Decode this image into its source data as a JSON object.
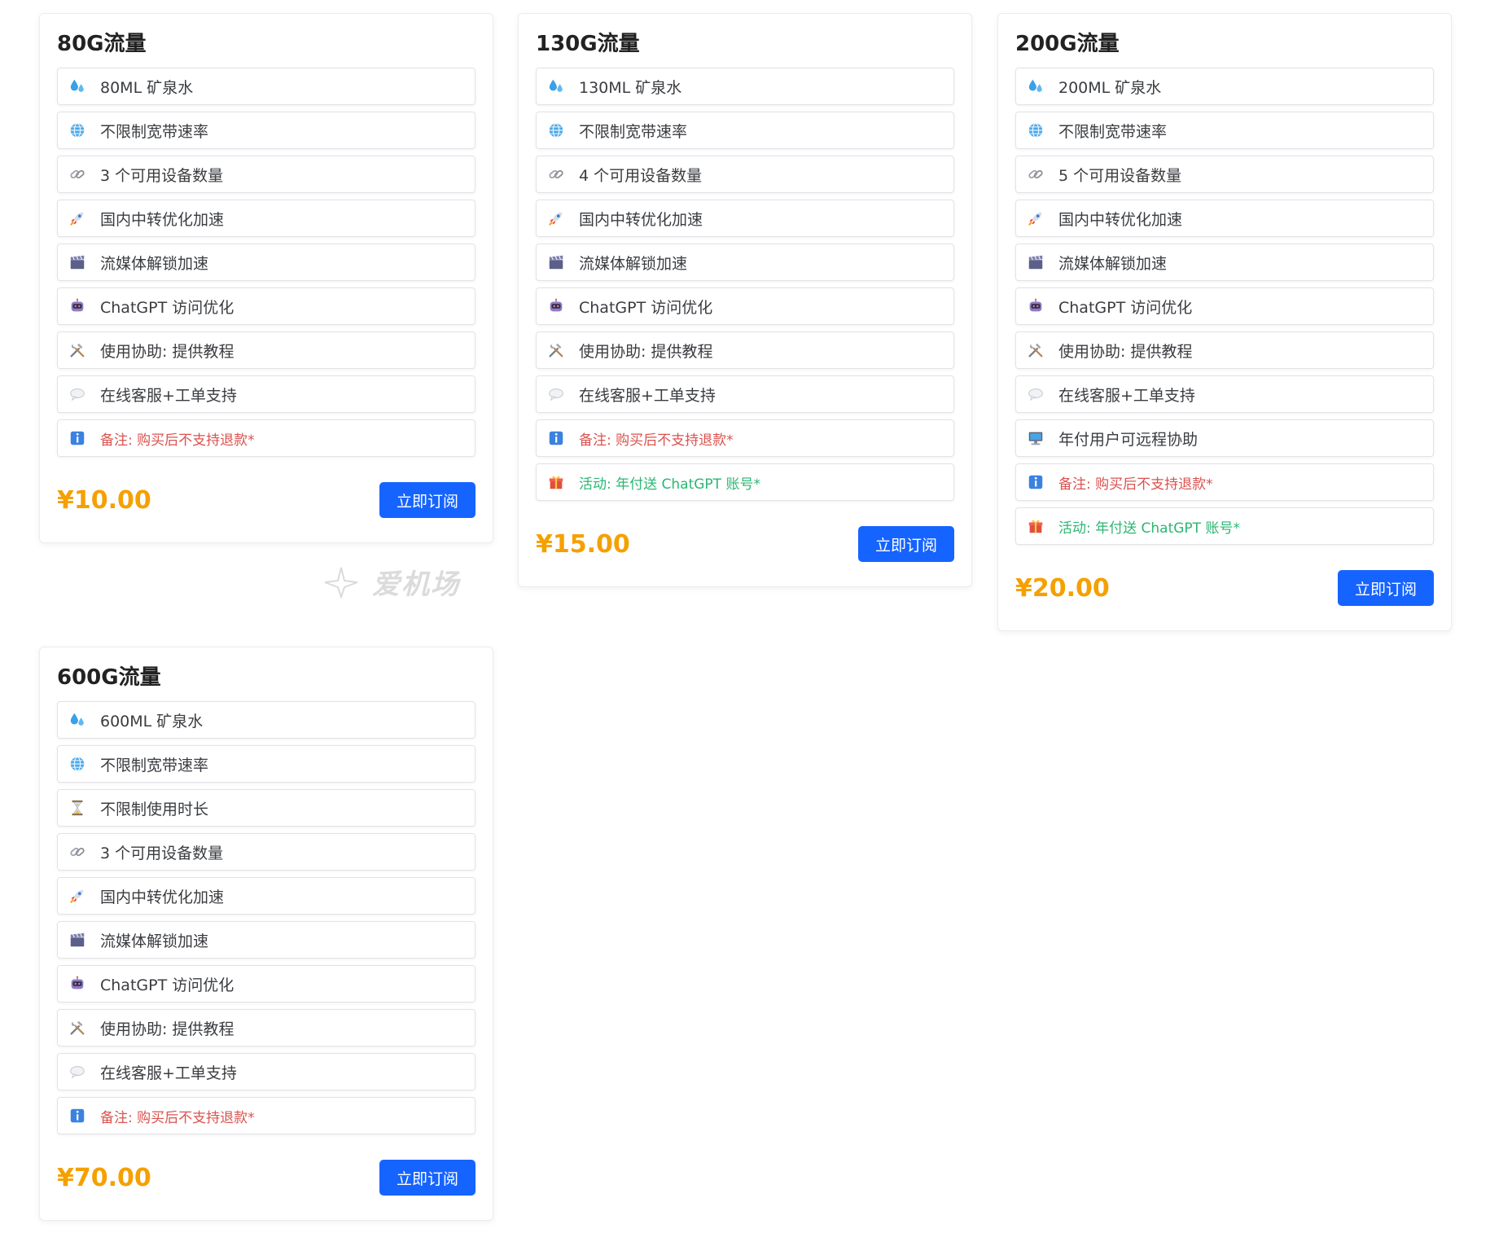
{
  "cards": [
    {
      "title": "80G流量",
      "features": [
        {
          "icon": "water-drops-icon",
          "text": "80ML 矿泉水",
          "kind": "normal"
        },
        {
          "icon": "globe-icon",
          "text": "不限制宽带速率",
          "kind": "normal"
        },
        {
          "icon": "link-icon",
          "text": "3 个可用设备数量",
          "kind": "normal"
        },
        {
          "icon": "rocket-icon",
          "text": "国内中转优化加速",
          "kind": "normal"
        },
        {
          "icon": "clapper-board-icon",
          "text": "流媒体解锁加速",
          "kind": "normal"
        },
        {
          "icon": "robot-icon",
          "text": "ChatGPT 访问优化",
          "kind": "normal"
        },
        {
          "icon": "tools-icon",
          "text": "使用协助: 提供教程",
          "kind": "normal"
        },
        {
          "icon": "speech-bubble-icon",
          "text": "在线客服+工单支持",
          "kind": "normal"
        },
        {
          "icon": "info-icon",
          "text": "备注: 购买后不支持退款*",
          "kind": "note"
        }
      ],
      "price": "¥10.00",
      "button": "立即订阅"
    },
    {
      "title": "130G流量",
      "features": [
        {
          "icon": "water-drops-icon",
          "text": "130ML 矿泉水",
          "kind": "normal"
        },
        {
          "icon": "globe-icon",
          "text": "不限制宽带速率",
          "kind": "normal"
        },
        {
          "icon": "link-icon",
          "text": "4 个可用设备数量",
          "kind": "normal"
        },
        {
          "icon": "rocket-icon",
          "text": "国内中转优化加速",
          "kind": "normal"
        },
        {
          "icon": "clapper-board-icon",
          "text": "流媒体解锁加速",
          "kind": "normal"
        },
        {
          "icon": "robot-icon",
          "text": "ChatGPT 访问优化",
          "kind": "normal"
        },
        {
          "icon": "tools-icon",
          "text": "使用协助: 提供教程",
          "kind": "normal"
        },
        {
          "icon": "speech-bubble-icon",
          "text": "在线客服+工单支持",
          "kind": "normal"
        },
        {
          "icon": "info-icon",
          "text": "备注: 购买后不支持退款*",
          "kind": "note"
        },
        {
          "icon": "gift-icon",
          "text": "活动: 年付送 ChatGPT 账号*",
          "kind": "promo"
        }
      ],
      "price": "¥15.00",
      "button": "立即订阅"
    },
    {
      "title": "200G流量",
      "features": [
        {
          "icon": "water-drops-icon",
          "text": "200ML 矿泉水",
          "kind": "normal"
        },
        {
          "icon": "globe-icon",
          "text": "不限制宽带速率",
          "kind": "normal"
        },
        {
          "icon": "link-icon",
          "text": "5 个可用设备数量",
          "kind": "normal"
        },
        {
          "icon": "rocket-icon",
          "text": "国内中转优化加速",
          "kind": "normal"
        },
        {
          "icon": "clapper-board-icon",
          "text": "流媒体解锁加速",
          "kind": "normal"
        },
        {
          "icon": "robot-icon",
          "text": "ChatGPT 访问优化",
          "kind": "normal"
        },
        {
          "icon": "tools-icon",
          "text": "使用协助: 提供教程",
          "kind": "normal"
        },
        {
          "icon": "speech-bubble-icon",
          "text": "在线客服+工单支持",
          "kind": "normal"
        },
        {
          "icon": "computer-icon",
          "text": "年付用户可远程协助",
          "kind": "normal"
        },
        {
          "icon": "info-icon",
          "text": "备注: 购买后不支持退款*",
          "kind": "note"
        },
        {
          "icon": "gift-icon",
          "text": "活动: 年付送 ChatGPT 账号*",
          "kind": "promo"
        }
      ],
      "price": "¥20.00",
      "button": "立即订阅"
    },
    {
      "title": "600G流量",
      "features": [
        {
          "icon": "water-drops-icon",
          "text": "600ML 矿泉水",
          "kind": "normal"
        },
        {
          "icon": "globe-icon",
          "text": "不限制宽带速率",
          "kind": "normal"
        },
        {
          "icon": "hourglass-icon",
          "text": "不限制使用时长",
          "kind": "normal"
        },
        {
          "icon": "link-icon",
          "text": "3 个可用设备数量",
          "kind": "normal"
        },
        {
          "icon": "rocket-icon",
          "text": "国内中转优化加速",
          "kind": "normal"
        },
        {
          "icon": "clapper-board-icon",
          "text": "流媒体解锁加速",
          "kind": "normal"
        },
        {
          "icon": "robot-icon",
          "text": "ChatGPT 访问优化",
          "kind": "normal"
        },
        {
          "icon": "tools-icon",
          "text": "使用协助: 提供教程",
          "kind": "normal"
        },
        {
          "icon": "speech-bubble-icon",
          "text": "在线客服+工单支持",
          "kind": "normal"
        },
        {
          "icon": "info-icon",
          "text": "备注: 购买后不支持退款*",
          "kind": "note"
        }
      ],
      "price": "¥70.00",
      "button": "立即订阅"
    }
  ],
  "watermark": {
    "text": "爱机场"
  },
  "colors": {
    "price": "#f5a000",
    "button": "#1664ff",
    "note": "#d9534f",
    "promo": "#2bb673"
  }
}
